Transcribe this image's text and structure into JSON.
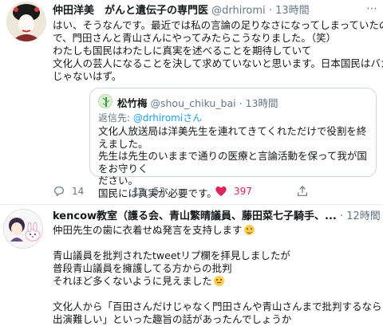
{
  "tweet1": {
    "name": "仲田洋美　がんと遺伝子の専門医",
    "handle": "@drhiromi",
    "separator": "·",
    "time": "13時間",
    "lines": [
      "はい、そうなんです。最近では私の言論の足りなさになってしまっていたの",
      "で、門田さんと青山さんにやってみたらこうなりました。（笑）",
      "わたしも国民はわたしに真実を述べることを期待していて",
      "文化人の芸人になることを決して求めていないと思います。日本国民はバカ",
      "じゃないはず。"
    ],
    "quote": {
      "name": "松竹梅",
      "handle": "@shou_chiku_bai",
      "separator": "·",
      "time": "13時間",
      "reply_prefix": "返信先:",
      "reply_mention": "@drhiromiさん",
      "lines": [
        "文化人放送局は洋美先生を連れてきてくれただけで役割を終えました。",
        "先生は先生のいままで通りの医療と言論活動を保って我が国をお守りく",
        "ださい。",
        "国民には真実が必要です。"
      ]
    },
    "actions": {
      "reply_count": "14",
      "retweet_count": "52",
      "like_count": "397",
      "like_color": "#e0245e"
    }
  },
  "tweet2": {
    "name": "kencow教室（護る会、青山繁晴議員、藤田菜七子騎手、...",
    "separator": "·",
    "time": "12時間",
    "lines": [
      "仲田先生の歯に衣着せぬ発言を支持します",
      "",
      "青山議員を批判されたtweetリプ欄を拝見しましたが",
      "普段青山議員を擁護してる方からの批判",
      "それほど多くないように見えました",
      "",
      "文化人から「百田さんだけじゃなく門田さんや青山さんまで批判するなら",
      "出演難しい」といった趣旨の話があったんでしょうか"
    ],
    "emojis": [
      "grinning-face-icon",
      "thinking-face-icon"
    ]
  },
  "icons": {
    "more": "⋯"
  }
}
